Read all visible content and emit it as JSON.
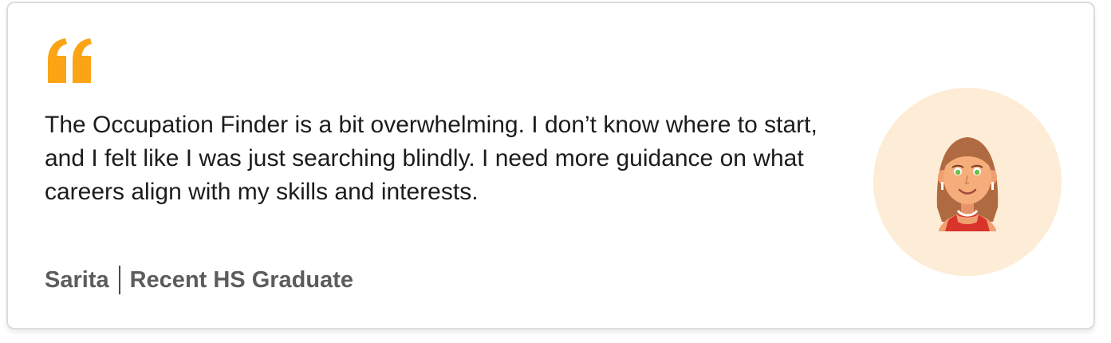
{
  "testimonial": {
    "quote_icon": "quote-mark-icon",
    "quote": "The Occupation Finder is a bit overwhelming. I don’t know where to start, and I felt like I was just searching blindly. I need more guidance on what careers align with my skills and interests.",
    "author_name": "Sarita",
    "author_role": "Recent HS Graduate",
    "avatar_icon": "woman-avatar-icon"
  },
  "colors": {
    "quote_icon": "#FBA416",
    "text": "#1c1c1c",
    "attribution": "#5c5c5c",
    "avatar_bg": "#fdecd6"
  }
}
